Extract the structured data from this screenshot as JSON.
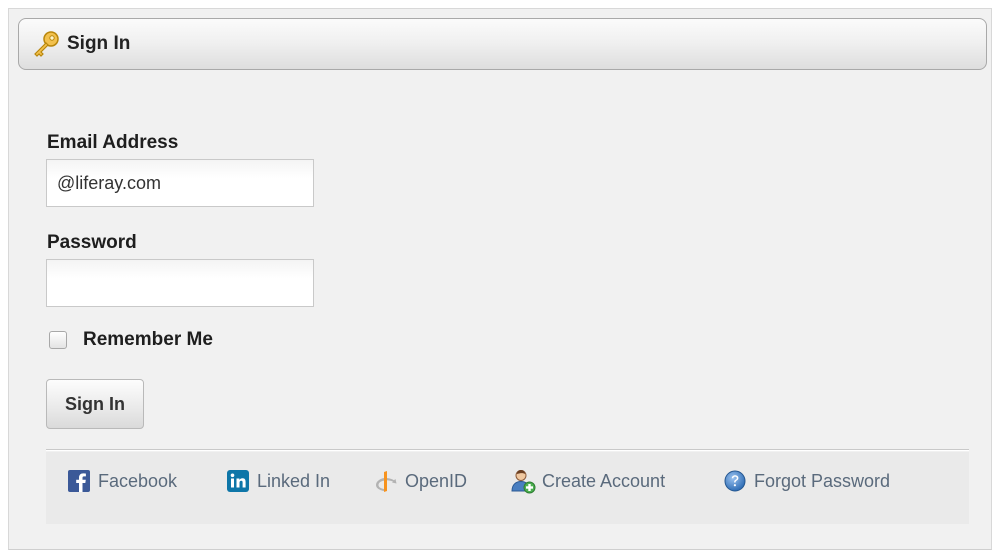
{
  "header": {
    "title": "Sign In",
    "icon": "key-icon"
  },
  "form": {
    "email_label": "Email Address",
    "email_value": "@liferay.com",
    "password_label": "Password",
    "password_value": "",
    "remember_label": "Remember Me",
    "remember_checked": false,
    "submit_label": "Sign In"
  },
  "navigation": [
    {
      "label": "Facebook",
      "icon": "facebook-icon"
    },
    {
      "label": "Linked In",
      "icon": "linkedin-icon"
    },
    {
      "label": "OpenID",
      "icon": "openid-icon"
    },
    {
      "label": "Create Account",
      "icon": "add-user-icon"
    },
    {
      "label": "Forgot Password",
      "icon": "help-icon"
    }
  ],
  "colors": {
    "link": "#5a6a7c",
    "facebook": "#3b5998",
    "linkedin": "#0e76a8",
    "openid": "#f7931e"
  }
}
